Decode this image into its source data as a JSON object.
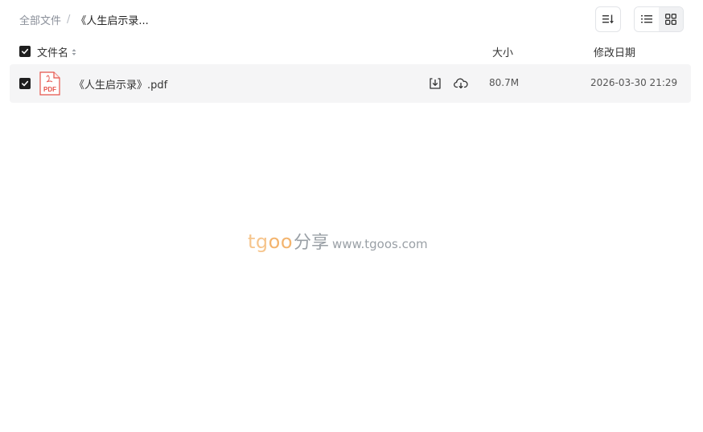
{
  "breadcrumb": {
    "root": "全部文件",
    "separator": "/",
    "current": "《人生启示录..."
  },
  "toolbar": {
    "sort_icon": "sort-list-icon",
    "list_view_icon": "list-view-icon",
    "grid_view_icon": "grid-view-icon",
    "active_view": "list"
  },
  "table": {
    "columns": {
      "name": "文件名",
      "size": "大小",
      "date": "修改日期"
    },
    "rows": [
      {
        "selected": true,
        "icon": "pdf-file-icon",
        "icon_text": "PDF",
        "name": "《人生启示录》.pdf",
        "size": "80.7M",
        "modified": "2026-03-30 21:29"
      }
    ]
  },
  "watermark": {
    "brand_part1": "tg",
    "brand_part2": "oo",
    "share": "分享",
    "url": "www.tgoos.com"
  },
  "colors": {
    "row_bg": "#f5f5f6",
    "checkbox": "#1f1f1f",
    "pdf_red": "#e5534b",
    "watermark_orange": "#f3b46e"
  }
}
